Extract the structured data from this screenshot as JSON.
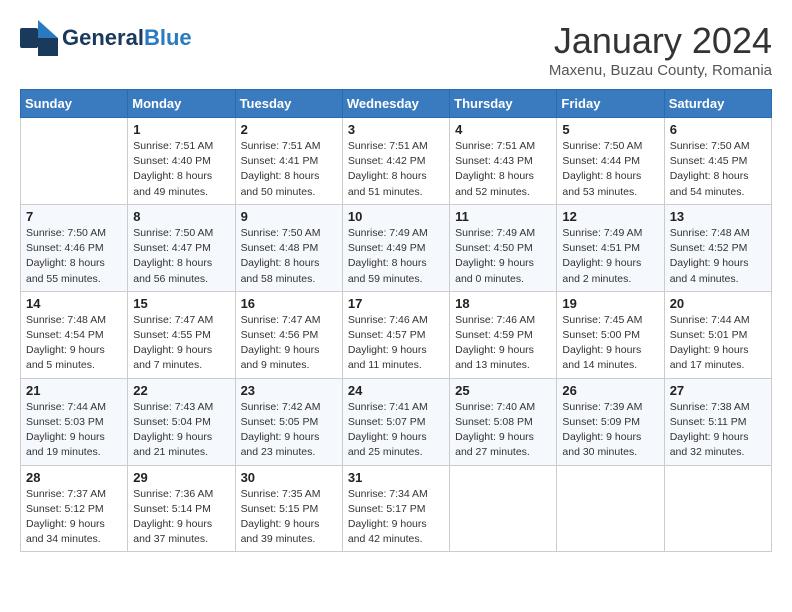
{
  "header": {
    "logo_general": "General",
    "logo_blue": "Blue",
    "month_title": "January 2024",
    "location": "Maxenu, Buzau County, Romania"
  },
  "calendar": {
    "days_of_week": [
      "Sunday",
      "Monday",
      "Tuesday",
      "Wednesday",
      "Thursday",
      "Friday",
      "Saturday"
    ],
    "weeks": [
      [
        {
          "day": "",
          "info": ""
        },
        {
          "day": "1",
          "info": "Sunrise: 7:51 AM\nSunset: 4:40 PM\nDaylight: 8 hours\nand 49 minutes."
        },
        {
          "day": "2",
          "info": "Sunrise: 7:51 AM\nSunset: 4:41 PM\nDaylight: 8 hours\nand 50 minutes."
        },
        {
          "day": "3",
          "info": "Sunrise: 7:51 AM\nSunset: 4:42 PM\nDaylight: 8 hours\nand 51 minutes."
        },
        {
          "day": "4",
          "info": "Sunrise: 7:51 AM\nSunset: 4:43 PM\nDaylight: 8 hours\nand 52 minutes."
        },
        {
          "day": "5",
          "info": "Sunrise: 7:50 AM\nSunset: 4:44 PM\nDaylight: 8 hours\nand 53 minutes."
        },
        {
          "day": "6",
          "info": "Sunrise: 7:50 AM\nSunset: 4:45 PM\nDaylight: 8 hours\nand 54 minutes."
        }
      ],
      [
        {
          "day": "7",
          "info": "Sunrise: 7:50 AM\nSunset: 4:46 PM\nDaylight: 8 hours\nand 55 minutes."
        },
        {
          "day": "8",
          "info": "Sunrise: 7:50 AM\nSunset: 4:47 PM\nDaylight: 8 hours\nand 56 minutes."
        },
        {
          "day": "9",
          "info": "Sunrise: 7:50 AM\nSunset: 4:48 PM\nDaylight: 8 hours\nand 58 minutes."
        },
        {
          "day": "10",
          "info": "Sunrise: 7:49 AM\nSunset: 4:49 PM\nDaylight: 8 hours\nand 59 minutes."
        },
        {
          "day": "11",
          "info": "Sunrise: 7:49 AM\nSunset: 4:50 PM\nDaylight: 9 hours\nand 0 minutes."
        },
        {
          "day": "12",
          "info": "Sunrise: 7:49 AM\nSunset: 4:51 PM\nDaylight: 9 hours\nand 2 minutes."
        },
        {
          "day": "13",
          "info": "Sunrise: 7:48 AM\nSunset: 4:52 PM\nDaylight: 9 hours\nand 4 minutes."
        }
      ],
      [
        {
          "day": "14",
          "info": "Sunrise: 7:48 AM\nSunset: 4:54 PM\nDaylight: 9 hours\nand 5 minutes."
        },
        {
          "day": "15",
          "info": "Sunrise: 7:47 AM\nSunset: 4:55 PM\nDaylight: 9 hours\nand 7 minutes."
        },
        {
          "day": "16",
          "info": "Sunrise: 7:47 AM\nSunset: 4:56 PM\nDaylight: 9 hours\nand 9 minutes."
        },
        {
          "day": "17",
          "info": "Sunrise: 7:46 AM\nSunset: 4:57 PM\nDaylight: 9 hours\nand 11 minutes."
        },
        {
          "day": "18",
          "info": "Sunrise: 7:46 AM\nSunset: 4:59 PM\nDaylight: 9 hours\nand 13 minutes."
        },
        {
          "day": "19",
          "info": "Sunrise: 7:45 AM\nSunset: 5:00 PM\nDaylight: 9 hours\nand 14 minutes."
        },
        {
          "day": "20",
          "info": "Sunrise: 7:44 AM\nSunset: 5:01 PM\nDaylight: 9 hours\nand 17 minutes."
        }
      ],
      [
        {
          "day": "21",
          "info": "Sunrise: 7:44 AM\nSunset: 5:03 PM\nDaylight: 9 hours\nand 19 minutes."
        },
        {
          "day": "22",
          "info": "Sunrise: 7:43 AM\nSunset: 5:04 PM\nDaylight: 9 hours\nand 21 minutes."
        },
        {
          "day": "23",
          "info": "Sunrise: 7:42 AM\nSunset: 5:05 PM\nDaylight: 9 hours\nand 23 minutes."
        },
        {
          "day": "24",
          "info": "Sunrise: 7:41 AM\nSunset: 5:07 PM\nDaylight: 9 hours\nand 25 minutes."
        },
        {
          "day": "25",
          "info": "Sunrise: 7:40 AM\nSunset: 5:08 PM\nDaylight: 9 hours\nand 27 minutes."
        },
        {
          "day": "26",
          "info": "Sunrise: 7:39 AM\nSunset: 5:09 PM\nDaylight: 9 hours\nand 30 minutes."
        },
        {
          "day": "27",
          "info": "Sunrise: 7:38 AM\nSunset: 5:11 PM\nDaylight: 9 hours\nand 32 minutes."
        }
      ],
      [
        {
          "day": "28",
          "info": "Sunrise: 7:37 AM\nSunset: 5:12 PM\nDaylight: 9 hours\nand 34 minutes."
        },
        {
          "day": "29",
          "info": "Sunrise: 7:36 AM\nSunset: 5:14 PM\nDaylight: 9 hours\nand 37 minutes."
        },
        {
          "day": "30",
          "info": "Sunrise: 7:35 AM\nSunset: 5:15 PM\nDaylight: 9 hours\nand 39 minutes."
        },
        {
          "day": "31",
          "info": "Sunrise: 7:34 AM\nSunset: 5:17 PM\nDaylight: 9 hours\nand 42 minutes."
        },
        {
          "day": "",
          "info": ""
        },
        {
          "day": "",
          "info": ""
        },
        {
          "day": "",
          "info": ""
        }
      ]
    ]
  }
}
